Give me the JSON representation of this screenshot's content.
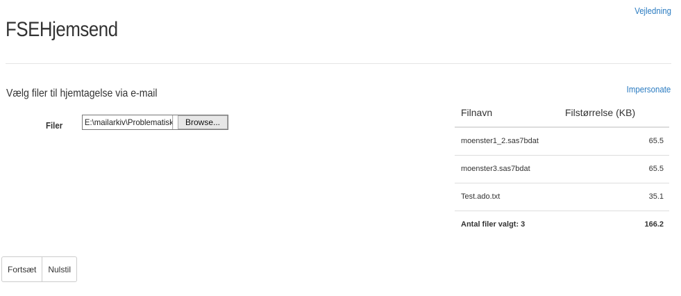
{
  "header": {
    "title_bold": "FSE",
    "title_rest": "Hjemsend",
    "help_link": "Vejledning"
  },
  "upload": {
    "heading": "Vælg filer til hjemtagelse via e-mail",
    "files_label": "Filer",
    "file_path": "E:\\mailarkiv\\Problematisk",
    "browse_label": "Browse..."
  },
  "actions": {
    "continue_label": "Fortsæt",
    "reset_label": "Nulstil"
  },
  "file_list": {
    "impersonate_link": "Impersonate",
    "columns": [
      "Filnavn",
      "Filstørrelse (KB)"
    ],
    "rows": [
      {
        "name": "moenster1_2.sas7bdat",
        "size": "65.5"
      },
      {
        "name": "moenster3.sas7bdat",
        "size": "65.5"
      },
      {
        "name": "Test.ado.txt",
        "size": "35.1"
      }
    ],
    "total_label": "Antal filer valgt: 3",
    "total_size": "166.2"
  }
}
